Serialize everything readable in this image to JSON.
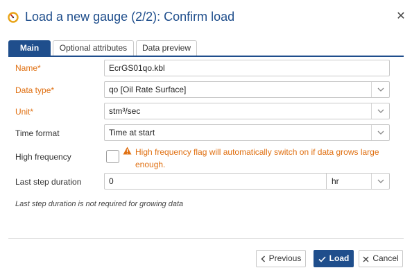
{
  "dialog": {
    "title": "Load a new gauge (2/2): Confirm load",
    "close_icon": "close-icon",
    "accent_color": "#1f4e8c",
    "required_color": "#e07012"
  },
  "tabs": [
    {
      "label": "Main",
      "active": true
    },
    {
      "label": "Optional attributes",
      "active": false
    },
    {
      "label": "Data preview",
      "active": false
    }
  ],
  "form": {
    "name": {
      "label": "Name",
      "value": "EcrGS01qo.kbl",
      "required": true
    },
    "data_type": {
      "label": "Data type",
      "value": "qo [Oil Rate Surface]",
      "required": true
    },
    "unit": {
      "label": "Unit",
      "value": "stm³/sec",
      "required": true
    },
    "time_format": {
      "label": "Time format",
      "value": "Time at start",
      "required": false
    },
    "high_frequency": {
      "label": "High frequency",
      "checked": false,
      "warning": "High frequency flag will automatically switch on if data grows large enough."
    },
    "last_step_duration": {
      "label": "Last step duration",
      "value": "0",
      "unit": "hr"
    },
    "note": "Last step duration is not required for growing data",
    "required_marker": "*"
  },
  "footer": {
    "previous_label": "Previous",
    "load_label": "Load",
    "cancel_label": "Cancel"
  }
}
